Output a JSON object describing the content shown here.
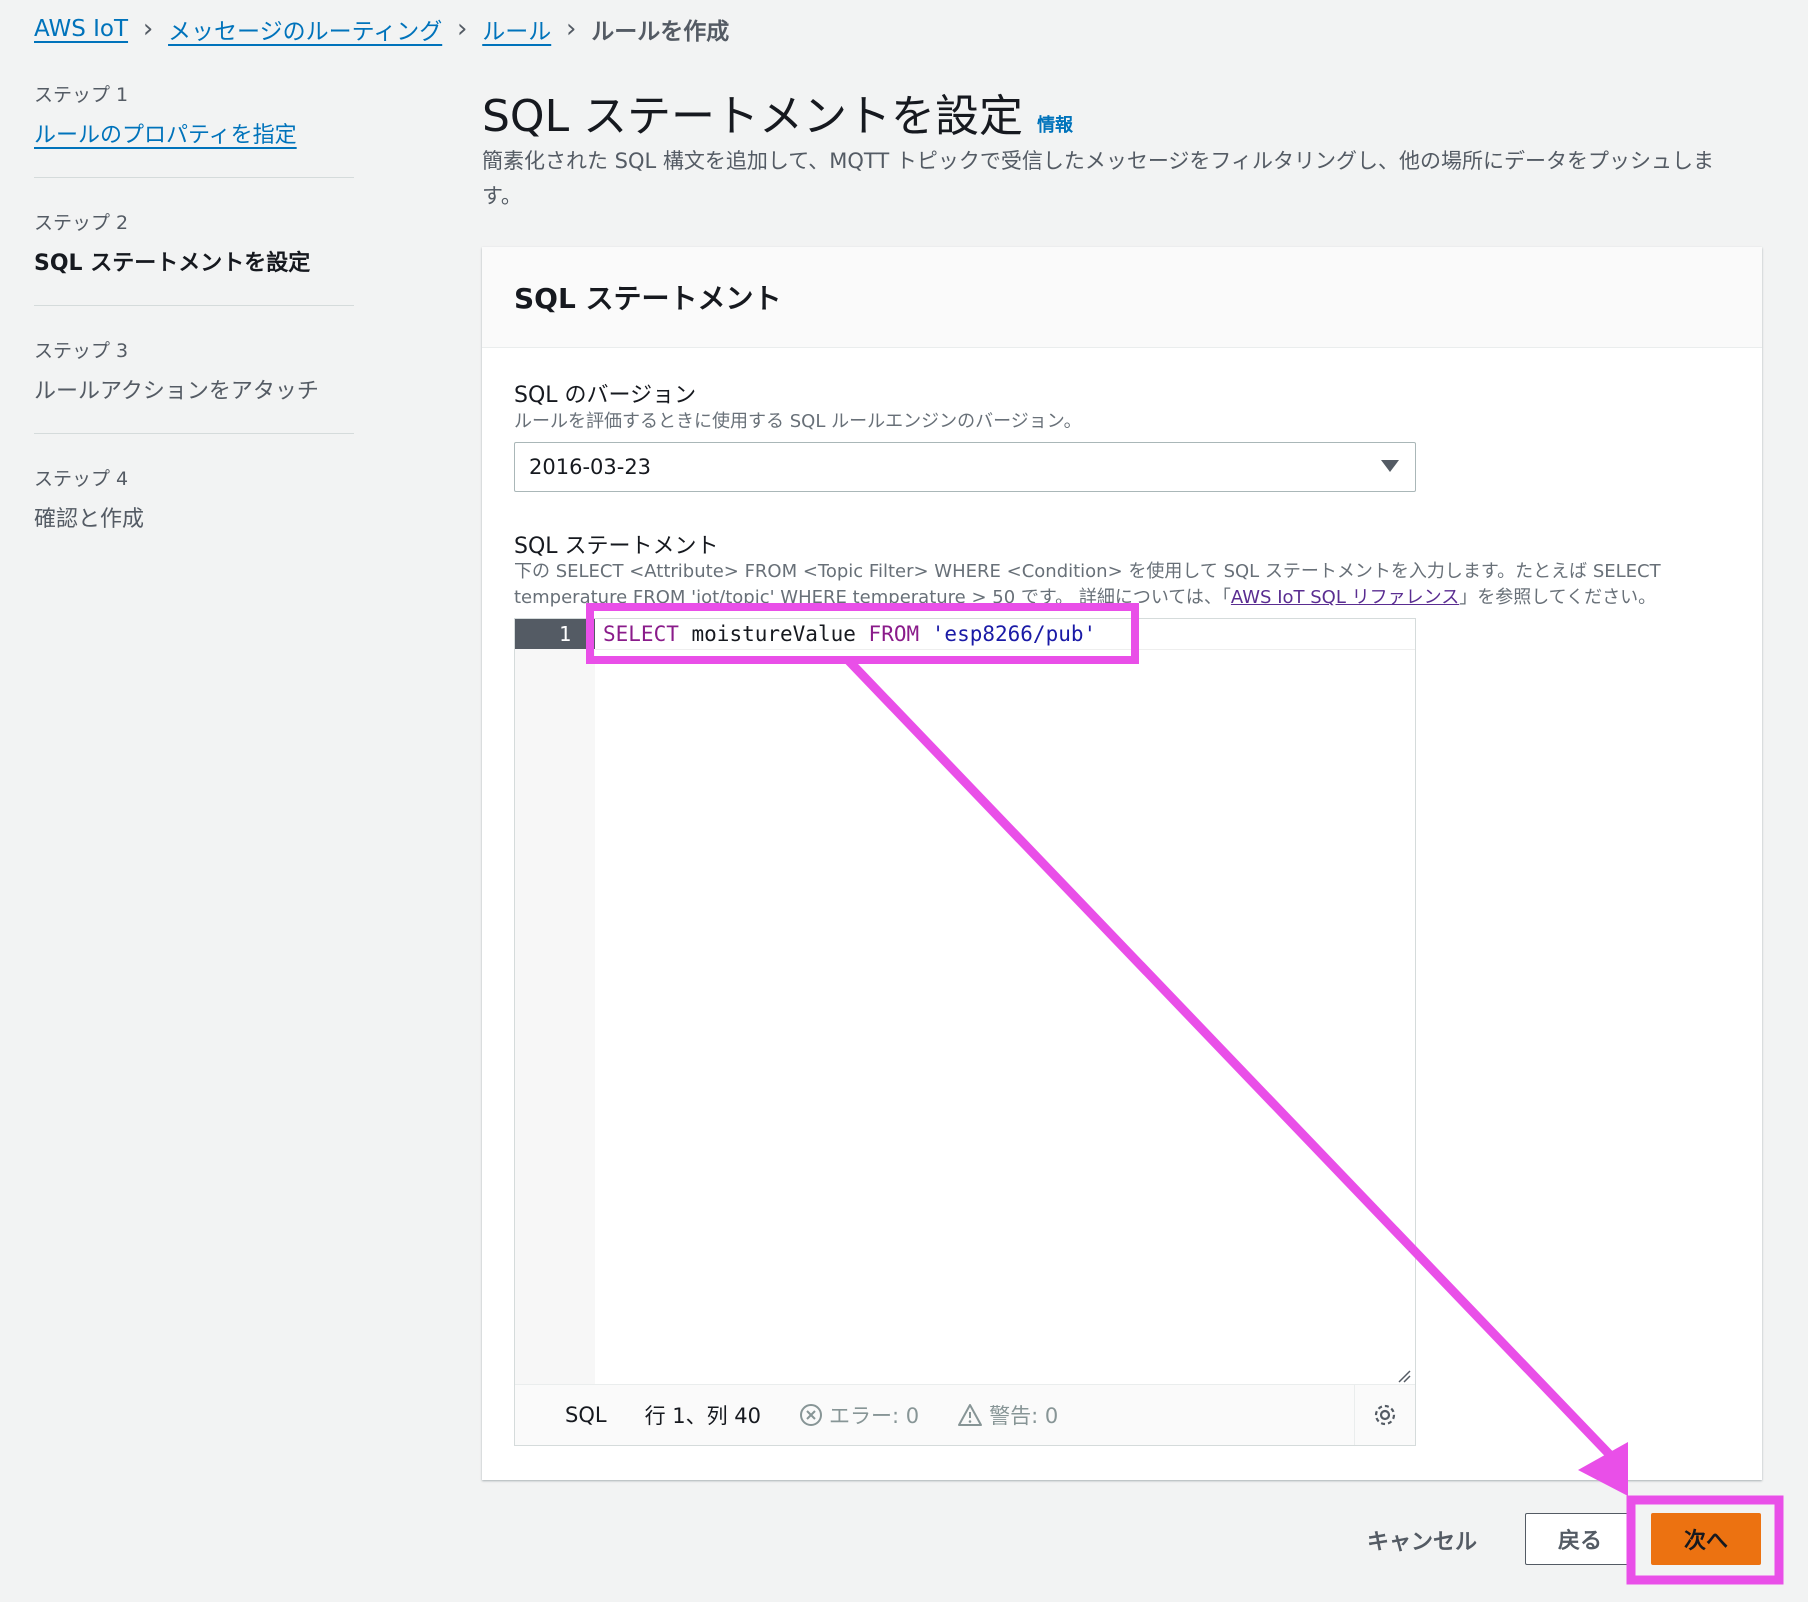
{
  "breadcrumb": {
    "items": [
      {
        "label": "AWS IoT"
      },
      {
        "label": "メッセージのルーティング"
      },
      {
        "label": "ルール"
      }
    ],
    "current": "ルールを作成"
  },
  "steps": [
    {
      "number": "ステップ 1",
      "title": "ルールのプロパティを指定"
    },
    {
      "number": "ステップ 2",
      "title": "SQL ステートメントを設定"
    },
    {
      "number": "ステップ 3",
      "title": "ルールアクションをアタッチ"
    },
    {
      "number": "ステップ 4",
      "title": "確認と作成"
    }
  ],
  "page": {
    "title": "SQL ステートメントを設定",
    "info_link": "情報",
    "description": "簡素化された SQL 構文を追加して、MQTT トピックで受信したメッセージをフィルタリングし、他の場所にデータをプッシュします。"
  },
  "panel": {
    "title": "SQL ステートメント",
    "sql_version": {
      "label": "SQL のバージョン",
      "description": "ルールを評価するときに使用する SQL ルールエンジンのバージョン。",
      "selected": "2016-03-23"
    },
    "sql_statement": {
      "label": "SQL ステートメント",
      "description_before_link": "下の SELECT <Attribute> FROM <Topic Filter> WHERE <Condition> を使用して SQL ステートメントを入力します。たとえば SELECT temperature FROM 'iot/topic' WHERE temperature > 50 です。 詳細については、「",
      "link_text": "AWS IoT SQL リファレンス",
      "description_after_link": "」を参照してください。"
    },
    "editor": {
      "line_number": "1",
      "code": {
        "kw_select": "SELECT",
        "field": "moistureValue",
        "kw_from": "FROM",
        "topic": "'esp8266/pub'"
      },
      "status": {
        "language": "SQL",
        "position": "行 1、列 40",
        "errors": "エラー: 0",
        "warnings": "警告: 0"
      }
    }
  },
  "footer": {
    "cancel": "キャンセル",
    "back": "戻る",
    "next": "次へ"
  },
  "colors": {
    "annotation": "#e94fe8",
    "primary_button": "#ec7211",
    "link": "#0073bb"
  }
}
